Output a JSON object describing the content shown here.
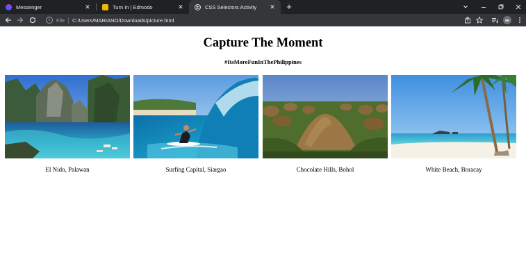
{
  "browser": {
    "tabs": [
      {
        "title": "Messenger",
        "favicon": "messenger-icon",
        "active": false
      },
      {
        "title": "Turn In | Edmodo",
        "favicon": "edmodo-icon",
        "active": false
      },
      {
        "title": "CSS Selectors Activity",
        "favicon": "globe-icon",
        "active": true
      }
    ],
    "new_tab_glyph": "+",
    "address": {
      "scheme_label": "File",
      "url": "C:/Users/MARIANO/Downloads/picture.html"
    }
  },
  "page": {
    "title": "Capture The Moment",
    "subtitle": "#ItsMoreFunInThePhilippines",
    "gallery": [
      {
        "caption": "El Nido, Palawan",
        "image": "lagoon-with-limestone-cliffs"
      },
      {
        "caption": "Surfing Capital, Siargao",
        "image": "surfer-riding-wave"
      },
      {
        "caption": "Chocolate Hills, Bohol",
        "image": "brown-conical-hills"
      },
      {
        "caption": "White Beach, Boracay",
        "image": "palm-tree-white-beach"
      }
    ]
  },
  "colors": {
    "chrome_dark": "#202124",
    "chrome_toolbar": "#35363a",
    "page_background": "#ffffff"
  }
}
